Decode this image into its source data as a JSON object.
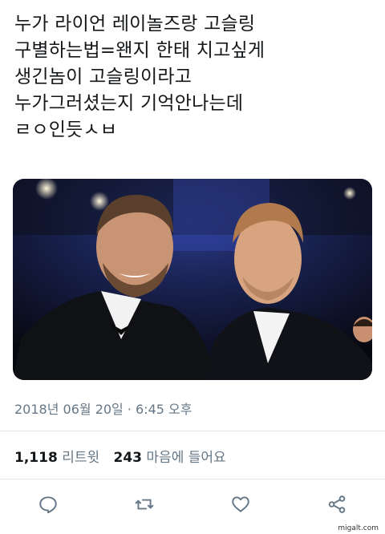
{
  "tweet": {
    "lines": [
      "누가 라이언 레이놀즈랑 고슬링",
      "구별하는법=왠지 한태 치고싶게",
      "생긴놈이 고슬링이라고",
      "누가그러셨는지 기억안나는데",
      "ㄹㅇ인듯ㅅㅂ"
    ],
    "timestamp": "2018년 06월 20일 · 6:45 오후"
  },
  "stats": {
    "retweets_count": "1,118",
    "retweets_label": "리트윗",
    "likes_count": "243",
    "likes_label": "마음에 들어요"
  },
  "actions": [
    {
      "name": "reply",
      "icon": "reply-icon"
    },
    {
      "name": "retweet",
      "icon": "retweet-icon"
    },
    {
      "name": "like",
      "icon": "heart-icon"
    },
    {
      "name": "share",
      "icon": "share-icon"
    }
  ],
  "watermark": "migalt.com",
  "colors": {
    "text": "#14171a",
    "secondary": "#657786",
    "divider": "#e1e8ed",
    "icon": "#657786"
  }
}
